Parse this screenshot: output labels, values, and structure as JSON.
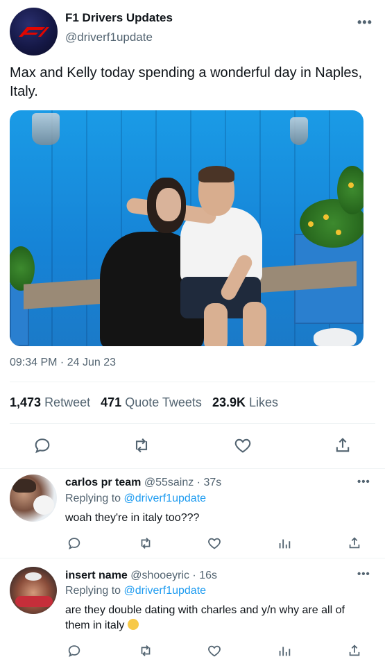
{
  "tweet": {
    "display_name": "F1 Drivers Updates",
    "handle": "@driverf1update",
    "more_label": "•••",
    "text": "Max and Kelly today spending a wonderful day in Naples, Italy.",
    "timestamp": "09:34 PM · 24 Jun 23",
    "stats": {
      "retweets_count": "1,473",
      "retweets_label": "Retweet",
      "quotes_count": "471",
      "quotes_label": "Quote Tweets",
      "likes_count": "23.9K",
      "likes_label": "Likes"
    },
    "actions": [
      "reply-icon",
      "retweet-icon",
      "like-icon",
      "share-icon"
    ]
  },
  "replies": [
    {
      "name": "carlos pr team",
      "meta": "@55sainz · 37s",
      "replying_prefix": "Replying to",
      "replying_to": "@driverf1update",
      "text": "woah they're in italy too???",
      "more_label": "•••"
    },
    {
      "name": "insert name",
      "meta": "@shooeyric · 16s",
      "replying_prefix": "Replying to",
      "replying_to": "@driverf1update",
      "text": "are they double dating with charles and y/n why are all of them in italy",
      "more_label": "•••"
    }
  ],
  "colors": {
    "accent": "#1d9bf0",
    "secondary_text": "#536471",
    "primary_text": "#0f1419",
    "divider": "#eff3f4"
  }
}
